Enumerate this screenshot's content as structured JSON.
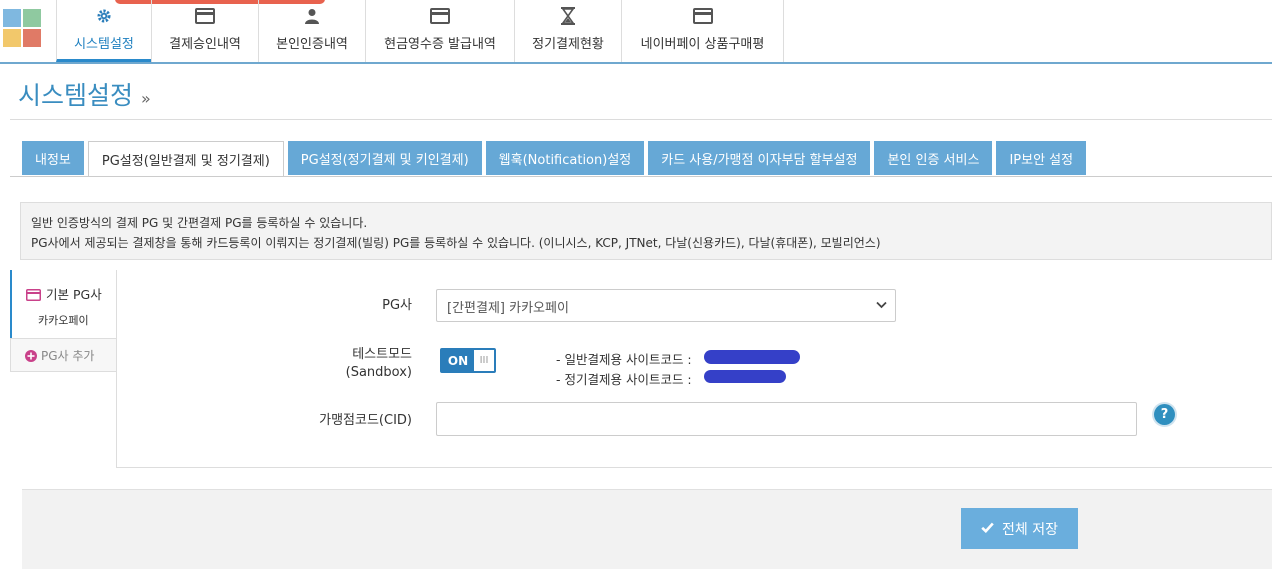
{
  "nav": {
    "items": [
      {
        "label": "시스템설정",
        "icon": "gear-icon",
        "active": true
      },
      {
        "label": "결제승인내역",
        "icon": "card-icon",
        "active": false
      },
      {
        "label": "본인인증내역",
        "icon": "user-icon",
        "active": false
      },
      {
        "label": "현금영수증 발급내역",
        "icon": "card-icon",
        "active": false
      },
      {
        "label": "정기결제현황",
        "icon": "hourglass-icon",
        "active": false
      },
      {
        "label": "네이버페이 상품구매평",
        "icon": "card-icon",
        "active": false
      }
    ]
  },
  "page": {
    "title": "시스템설정",
    "title_suffix": "»"
  },
  "tabs": [
    {
      "label": "내정보",
      "active": false
    },
    {
      "label": "PG설정(일반결제 및 정기결제)",
      "active": true
    },
    {
      "label": "PG설정(정기결제 및 키인결제)",
      "active": false
    },
    {
      "label": "웹훅(Notification)설정",
      "active": false
    },
    {
      "label": "카드 사용/가맹점 이자부담 할부설정",
      "active": false
    },
    {
      "label": "본인 인증 서비스",
      "active": false
    },
    {
      "label": "IP보안 설정",
      "active": false
    }
  ],
  "info": {
    "line1": "일반 인증방식의 결제 PG 및 간편결제 PG를 등록하실 수 있습니다.",
    "line2": "PG사에서 제공되는 결제창을 통해 카드등록이 이뤄지는 정기결제(빌링) PG를 등록하실 수 있습니다. (이니시스, KCP, JTNet, 다날(신용카드), 다날(휴대폰), 모빌리언스)"
  },
  "pg_list": {
    "main_label": "기본 PG사",
    "main_sub": "카카오페이",
    "add_label": "PG사 추가"
  },
  "form": {
    "pg_label": "PG사",
    "pg_value": "[간편결제] 카카오페이",
    "test_label_1": "테스트모드",
    "test_label_2": "(Sandbox)",
    "toggle_on": "ON",
    "toggle_grip": "III",
    "site_code_normal": "- 일반결제용 사이트코드 :",
    "site_code_recurring": "- 정기결제용 사이트코드 :",
    "cid_label": "가맹점코드(CID)",
    "cid_value": "",
    "help": "?"
  },
  "footer": {
    "save_label": "전체 저장"
  },
  "colors": {
    "accent": "#2a8acb",
    "tab_bg": "#66a8d6",
    "save_bg": "#6aaedd"
  }
}
